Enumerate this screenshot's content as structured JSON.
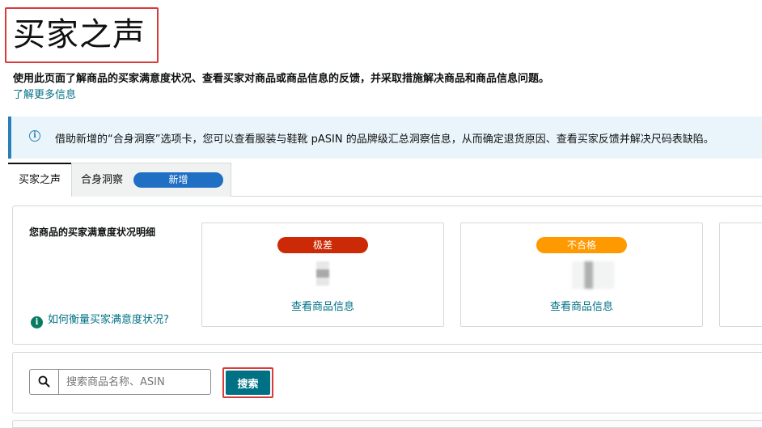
{
  "page": {
    "title": "买家之声",
    "description": "使用此页面了解商品的买家满意度状况、查看买家对商品或商品信息的反馈，并采取措施解决商品和商品信息问题。",
    "learn_more": "了解更多信息"
  },
  "banner": {
    "icon": "info-icon",
    "text": "借助新增的“合身洞察”选项卡，您可以查看服装与鞋靴 pASIN 的品牌级汇总洞察信息，从而确定退货原因、查看买家反馈并解决尺码表缺陷。"
  },
  "tabs": [
    {
      "label": "买家之声",
      "selected": true
    },
    {
      "label": "合身洞察",
      "badge": "新增",
      "selected": false
    }
  ],
  "satisfaction": {
    "heading": "您商品的买家满意度状况明细",
    "how_link": "如何衡量买家满意度状况?",
    "cards": [
      {
        "rating": "极差",
        "rating_color": "#cc2a06",
        "link": "查看商品信息"
      },
      {
        "rating": "不合格",
        "rating_color": "#ff9900",
        "link": "查看商品信息"
      }
    ]
  },
  "search": {
    "placeholder": "搜索商品名称、ASIN",
    "value": "",
    "button_label": "搜索"
  },
  "colors": {
    "link": "#007185",
    "primary_button": "#007185",
    "badge_new": "#1f6fc5",
    "highlight_outline": "#d93a3a",
    "banner_bg": "#eaf5fb"
  }
}
